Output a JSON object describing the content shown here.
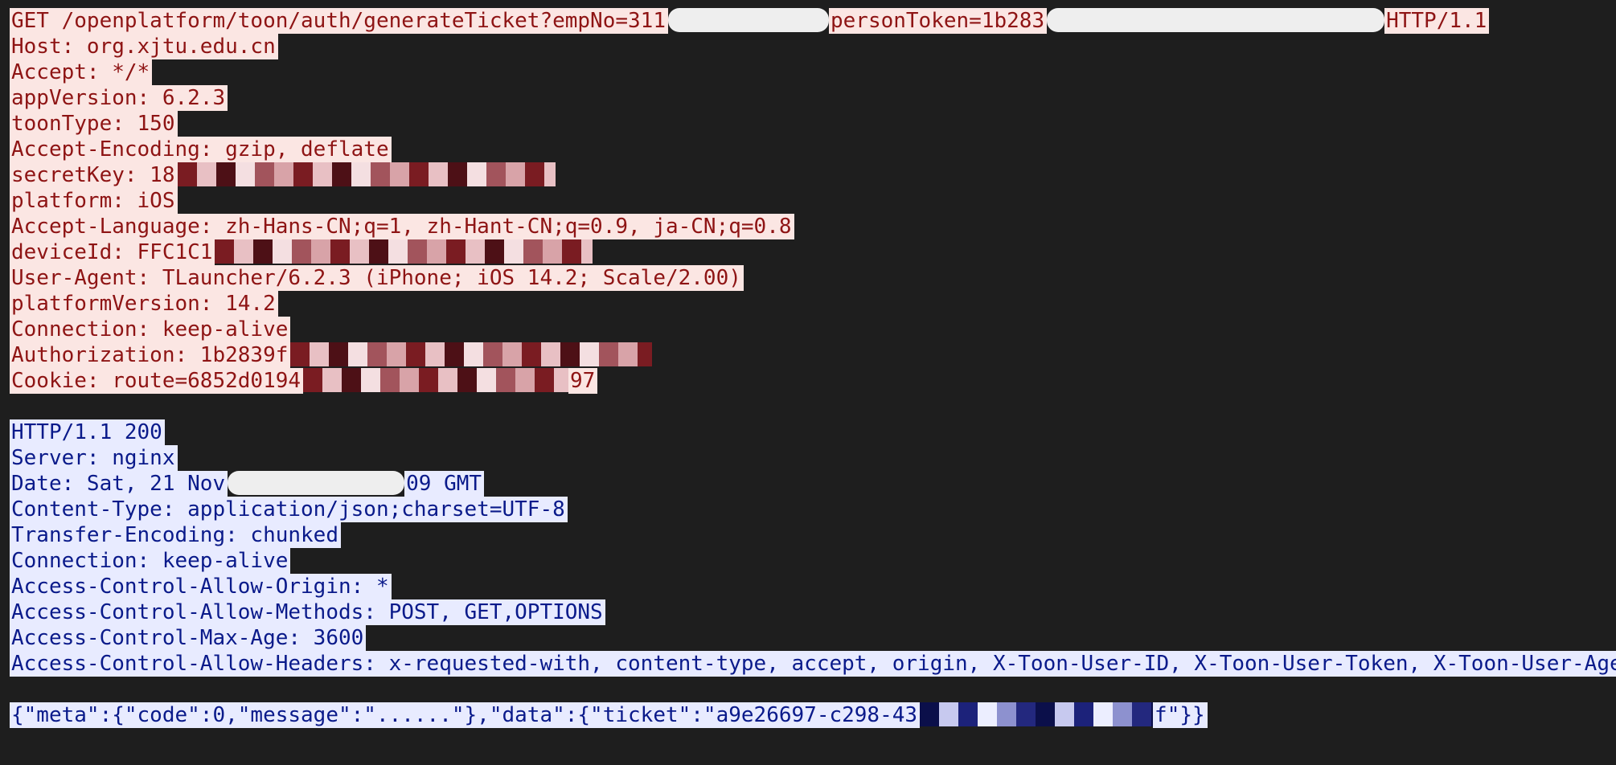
{
  "request": {
    "lines": [
      "GET /openplatform/toon/auth/generateTicket?empNo=311",
      "personToken=1b283",
      "HTTP/1.1",
      "Host: org.xjtu.edu.cn",
      "Accept: */*",
      "appVersion: 6.2.3",
      "toonType: 150",
      "Accept-Encoding: gzip, deflate",
      "secretKey: 18",
      "platform: iOS",
      "Accept-Language: zh-Hans-CN;q=1, zh-Hant-CN;q=0.9, ja-CN;q=0.8",
      "deviceId: FFC1C1",
      "User-Agent: TLauncher/6.2.3 (iPhone; iOS 14.2; Scale/2.00)",
      "platformVersion: 14.2",
      "Connection: keep-alive",
      "Authorization: 1b2839f",
      "Cookie: route=6852d0194",
      "97"
    ]
  },
  "response": {
    "lines": [
      "HTTP/1.1 200",
      "Server: nginx",
      "Date: Sat, 21 Nov",
      "09 GMT",
      "Content-Type: application/json;charset=UTF-8",
      "Transfer-Encoding: chunked",
      "Connection: keep-alive",
      "Access-Control-Allow-Origin: *",
      "Access-Control-Allow-Methods: POST, GET,OPTIONS",
      "Access-Control-Max-Age: 3600",
      "Access-Control-Allow-Headers: x-requested-with, content-type, accept, origin, X-Toon-User-ID, X-Toon-User-Token, X-Toon-User-Age"
    ],
    "body": [
      "{\"meta\":{\"code\":0,\"message\":\"......\"},\"data\":{\"ticket\":\"a9e26697-c298-43",
      "f\"}}"
    ]
  },
  "colors": {
    "background": "#1e1e1e",
    "request_text": "#8e1414",
    "request_highlight": "#fbe6e3",
    "response_text": "#0a1a8a",
    "response_highlight": "#e8ebff"
  }
}
